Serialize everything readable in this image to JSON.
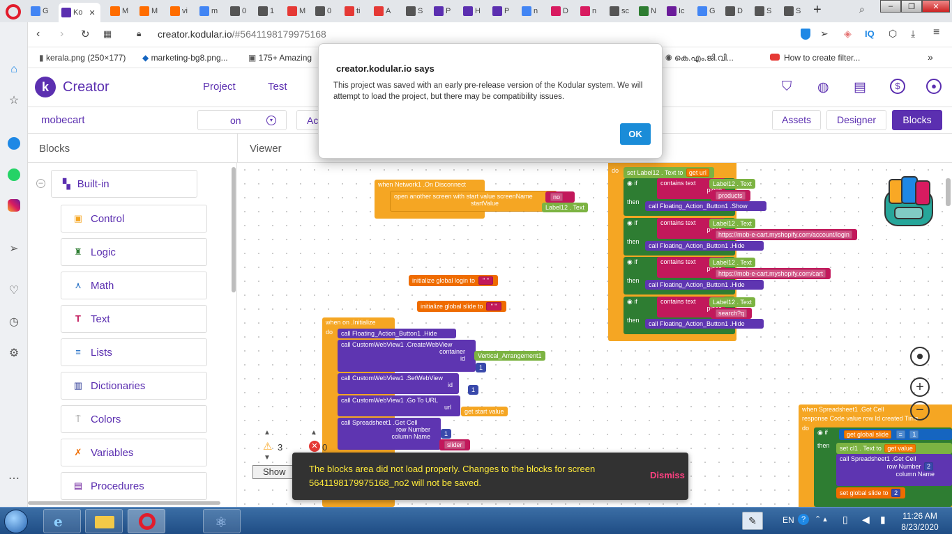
{
  "browser": {
    "tabs": [
      {
        "label": "G",
        "color": "#4285f4"
      },
      {
        "label": "Ko",
        "color": "#5b2fb0",
        "active": true
      },
      {
        "label": "M",
        "color": "#ff6d00"
      },
      {
        "label": "M",
        "color": "#ff6d00"
      },
      {
        "label": "vi",
        "color": "#ff6d00"
      },
      {
        "label": "m",
        "color": "#4285f4"
      },
      {
        "label": "0",
        "color": "#555"
      },
      {
        "label": "1",
        "color": "#555"
      },
      {
        "label": "M",
        "color": "#e53935"
      },
      {
        "label": "0",
        "color": "#555"
      },
      {
        "label": "ti",
        "color": "#e53935"
      },
      {
        "label": "A",
        "color": "#e53935"
      },
      {
        "label": "S",
        "color": "#555"
      },
      {
        "label": "P",
        "color": "#5b2fb0"
      },
      {
        "label": "H",
        "color": "#5b2fb0"
      },
      {
        "label": "P",
        "color": "#5b2fb0"
      },
      {
        "label": "n",
        "color": "#4285f4"
      },
      {
        "label": "D",
        "color": "#d81b60"
      },
      {
        "label": "n",
        "color": "#d81b60"
      },
      {
        "label": "sc",
        "color": "#555"
      },
      {
        "label": "N",
        "color": "#2e7d32"
      },
      {
        "label": "Ic",
        "color": "#6a1b9a"
      },
      {
        "label": "G",
        "color": "#4285f4"
      },
      {
        "label": "D",
        "color": "#555"
      },
      {
        "label": "S",
        "color": "#555"
      },
      {
        "label": "S",
        "color": "#555"
      }
    ],
    "url_host": "creator.kodular.io",
    "url_path": "/#5641198179975168",
    "bookmarks": [
      "kerala.png (250×177)",
      "marketing-bg8.png...",
      "175+ Amazing",
      "കെ.എം.ജി.വി...",
      "How to create filter..."
    ],
    "sidebar_icons": [
      "home-icon",
      "star-icon",
      "messenger-icon",
      "whatsapp-icon",
      "instagram-icon",
      "send-icon",
      "heart-icon",
      "history-icon",
      "settings-icon",
      "more-icon"
    ]
  },
  "app": {
    "brand": "Creator",
    "brand_letter": "k",
    "menu": [
      "Project",
      "Test"
    ],
    "project_name": "mobecart",
    "screen_selector": "on",
    "add_screen_label": "Ac",
    "view_buttons": {
      "assets": "Assets",
      "designer": "Designer",
      "blocks": "Blocks"
    },
    "panel_blocks_title": "Blocks",
    "panel_viewer_title": "Viewer",
    "builtin_label": "Built-in",
    "builtin_items": [
      "Control",
      "Logic",
      "Math",
      "Text",
      "Lists",
      "Dictionaries",
      "Colors",
      "Variables",
      "Procedures"
    ],
    "warnings_count": "3",
    "errors_count": "0",
    "show_warnings_label": "Show W"
  },
  "blocks": {
    "network_event": "when  Network1  .On Disconnect",
    "open_screen": "open another screen with start value  screenName",
    "no_text": "no",
    "start_value_label": "startValue",
    "label12_text": "Label12  .  Text",
    "init_login": "initialize global  login  to",
    "init_slide": "initialize global  slide  to",
    "when_initialize": "when  on  .Initialize",
    "fab_hide": "call  Floating_Action_Button1  .Hide",
    "fab_show": "call  Floating_Action_Button1  .Show",
    "create_webview": "call  CustomWebView1  .CreateWebView",
    "container_label": "container",
    "vertical_arrangement": "Vertical_Arrangement1",
    "id_label": "id",
    "one": "1",
    "two": "2",
    "set_webview": "call  CustomWebView1  .SetWebView",
    "go_to_url": "call  CustomWebView1  .Go To URL",
    "url_label": "url",
    "get_start_value": "get start value",
    "get_cell": "call  Spreadsheet1  .Get Cell",
    "row_number": "row Number",
    "column_name": "column Name",
    "slider": "slider",
    "set_label12": "set  Label12  .  Text  to",
    "get_url": "get  url",
    "do_label": "do",
    "if_label": "if",
    "then_label": "then",
    "contains_text": "contains  text",
    "piece_label": "piece",
    "piece_products": "products",
    "piece_login": "https://mob-e-cart.myshopify.com/account/login",
    "piece_cart": "https://mob-e-cart.myshopify.com/cart",
    "piece_search": "search?q",
    "ss_event": "when  Spreadsheet1  .Got Cell",
    "ss_params": "response Code   value   row Id   created Time",
    "get_global_slide": "get  global slide",
    "equals": "=",
    "set_cl1": "set  cl1  .  Text  to",
    "get_value": "get  value",
    "set_global_slide": "set  global slide  to"
  },
  "dialog": {
    "title": "creator.kodular.io says",
    "message": "This project was saved with an early pre-release version of the Kodular system. We will attempt to load the project, but there may be compatibility issues.",
    "ok": "OK"
  },
  "toast": {
    "message": "The blocks area did not load properly. Changes to the blocks for screen 5641198179975168_no2 will not be saved.",
    "dismiss": "Dismiss"
  },
  "taskbar": {
    "lang": "EN",
    "time": "11:26 AM",
    "date": "8/23/2020"
  }
}
